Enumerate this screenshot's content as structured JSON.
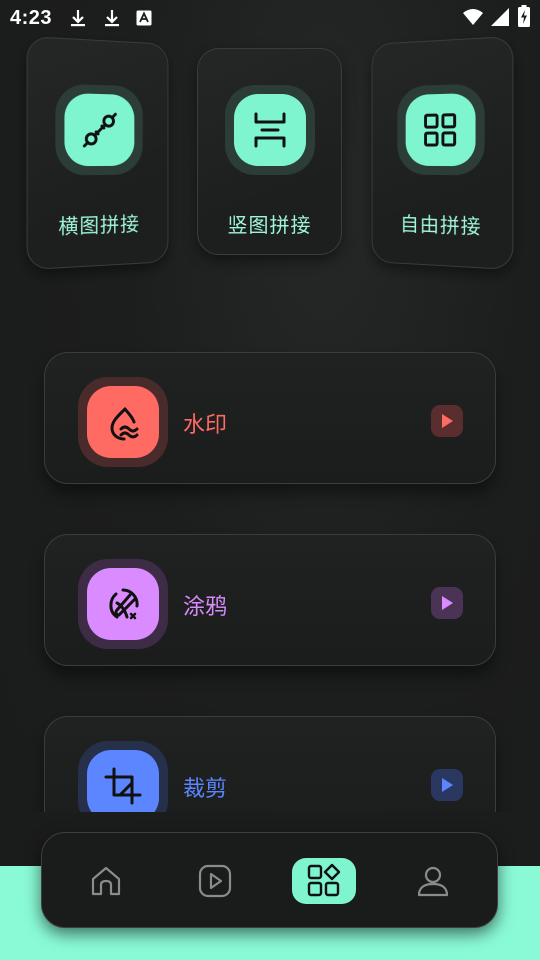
{
  "status_bar": {
    "time": "4:23",
    "icons": [
      "download-icon",
      "download-icon",
      "keyboard-a-icon",
      "wifi-icon",
      "signal-icon",
      "battery-charging-icon"
    ]
  },
  "top_cards": [
    {
      "label": "横图拼接",
      "icon": "link-nodes-icon"
    },
    {
      "label": "竖图拼接",
      "icon": "vertical-split-icon"
    },
    {
      "label": "自由拼接",
      "icon": "grid-icon"
    }
  ],
  "tools": [
    {
      "label": "水印",
      "icon": "watermark-drop-icon",
      "accent": "#ff6a63",
      "ring": "#4a2b2b",
      "play_bg": "#5a2e2e"
    },
    {
      "label": "涂鸦",
      "icon": "doodle-brush-icon",
      "accent": "#d98bff",
      "ring": "#3e2c47",
      "play_bg": "#4a3355"
    },
    {
      "label": "裁剪",
      "icon": "crop-icon",
      "accent": "#5b86ff",
      "ring": "#26304a",
      "play_bg": "#2a3760"
    }
  ],
  "nav": {
    "items": [
      "home-icon",
      "play-icon",
      "tools-grid-icon",
      "profile-icon"
    ],
    "active_index": 2
  },
  "colors": {
    "accent_mint": "#7ef5cf",
    "background": "#1b1c1c"
  }
}
